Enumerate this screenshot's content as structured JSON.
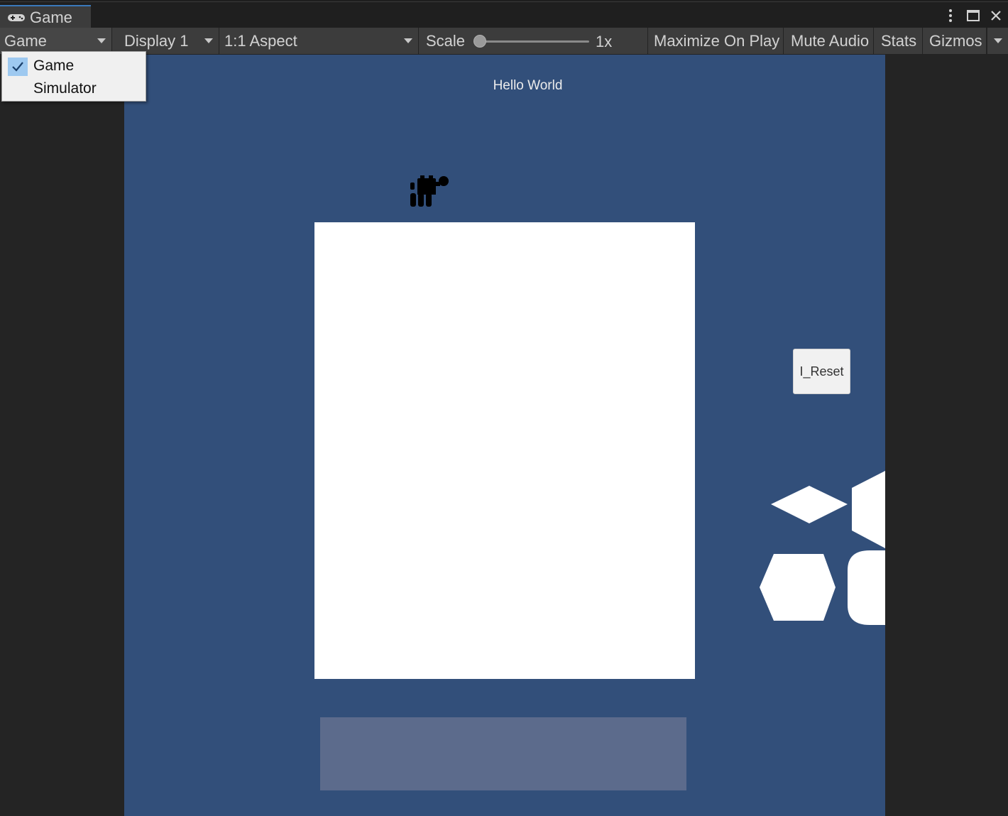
{
  "window": {
    "tab_title": "Game"
  },
  "toolbar": {
    "view_mode_label": "Game",
    "display_label": "Display 1",
    "aspect_label": "1:1 Aspect",
    "scale_label": "Scale",
    "scale_value": "1x",
    "scale_level": 0.0,
    "maximize_label": "Maximize On Play",
    "mute_label": "Mute Audio",
    "stats_label": "Stats",
    "gizmos_label": "Gizmos"
  },
  "view_mode_menu": {
    "items": [
      {
        "label": "Game",
        "checked": true
      },
      {
        "label": "Simulator",
        "checked": false
      }
    ]
  },
  "game": {
    "hello_text": "Hello World",
    "reset_label": "I_Reset",
    "background_color": "#324f7a"
  }
}
